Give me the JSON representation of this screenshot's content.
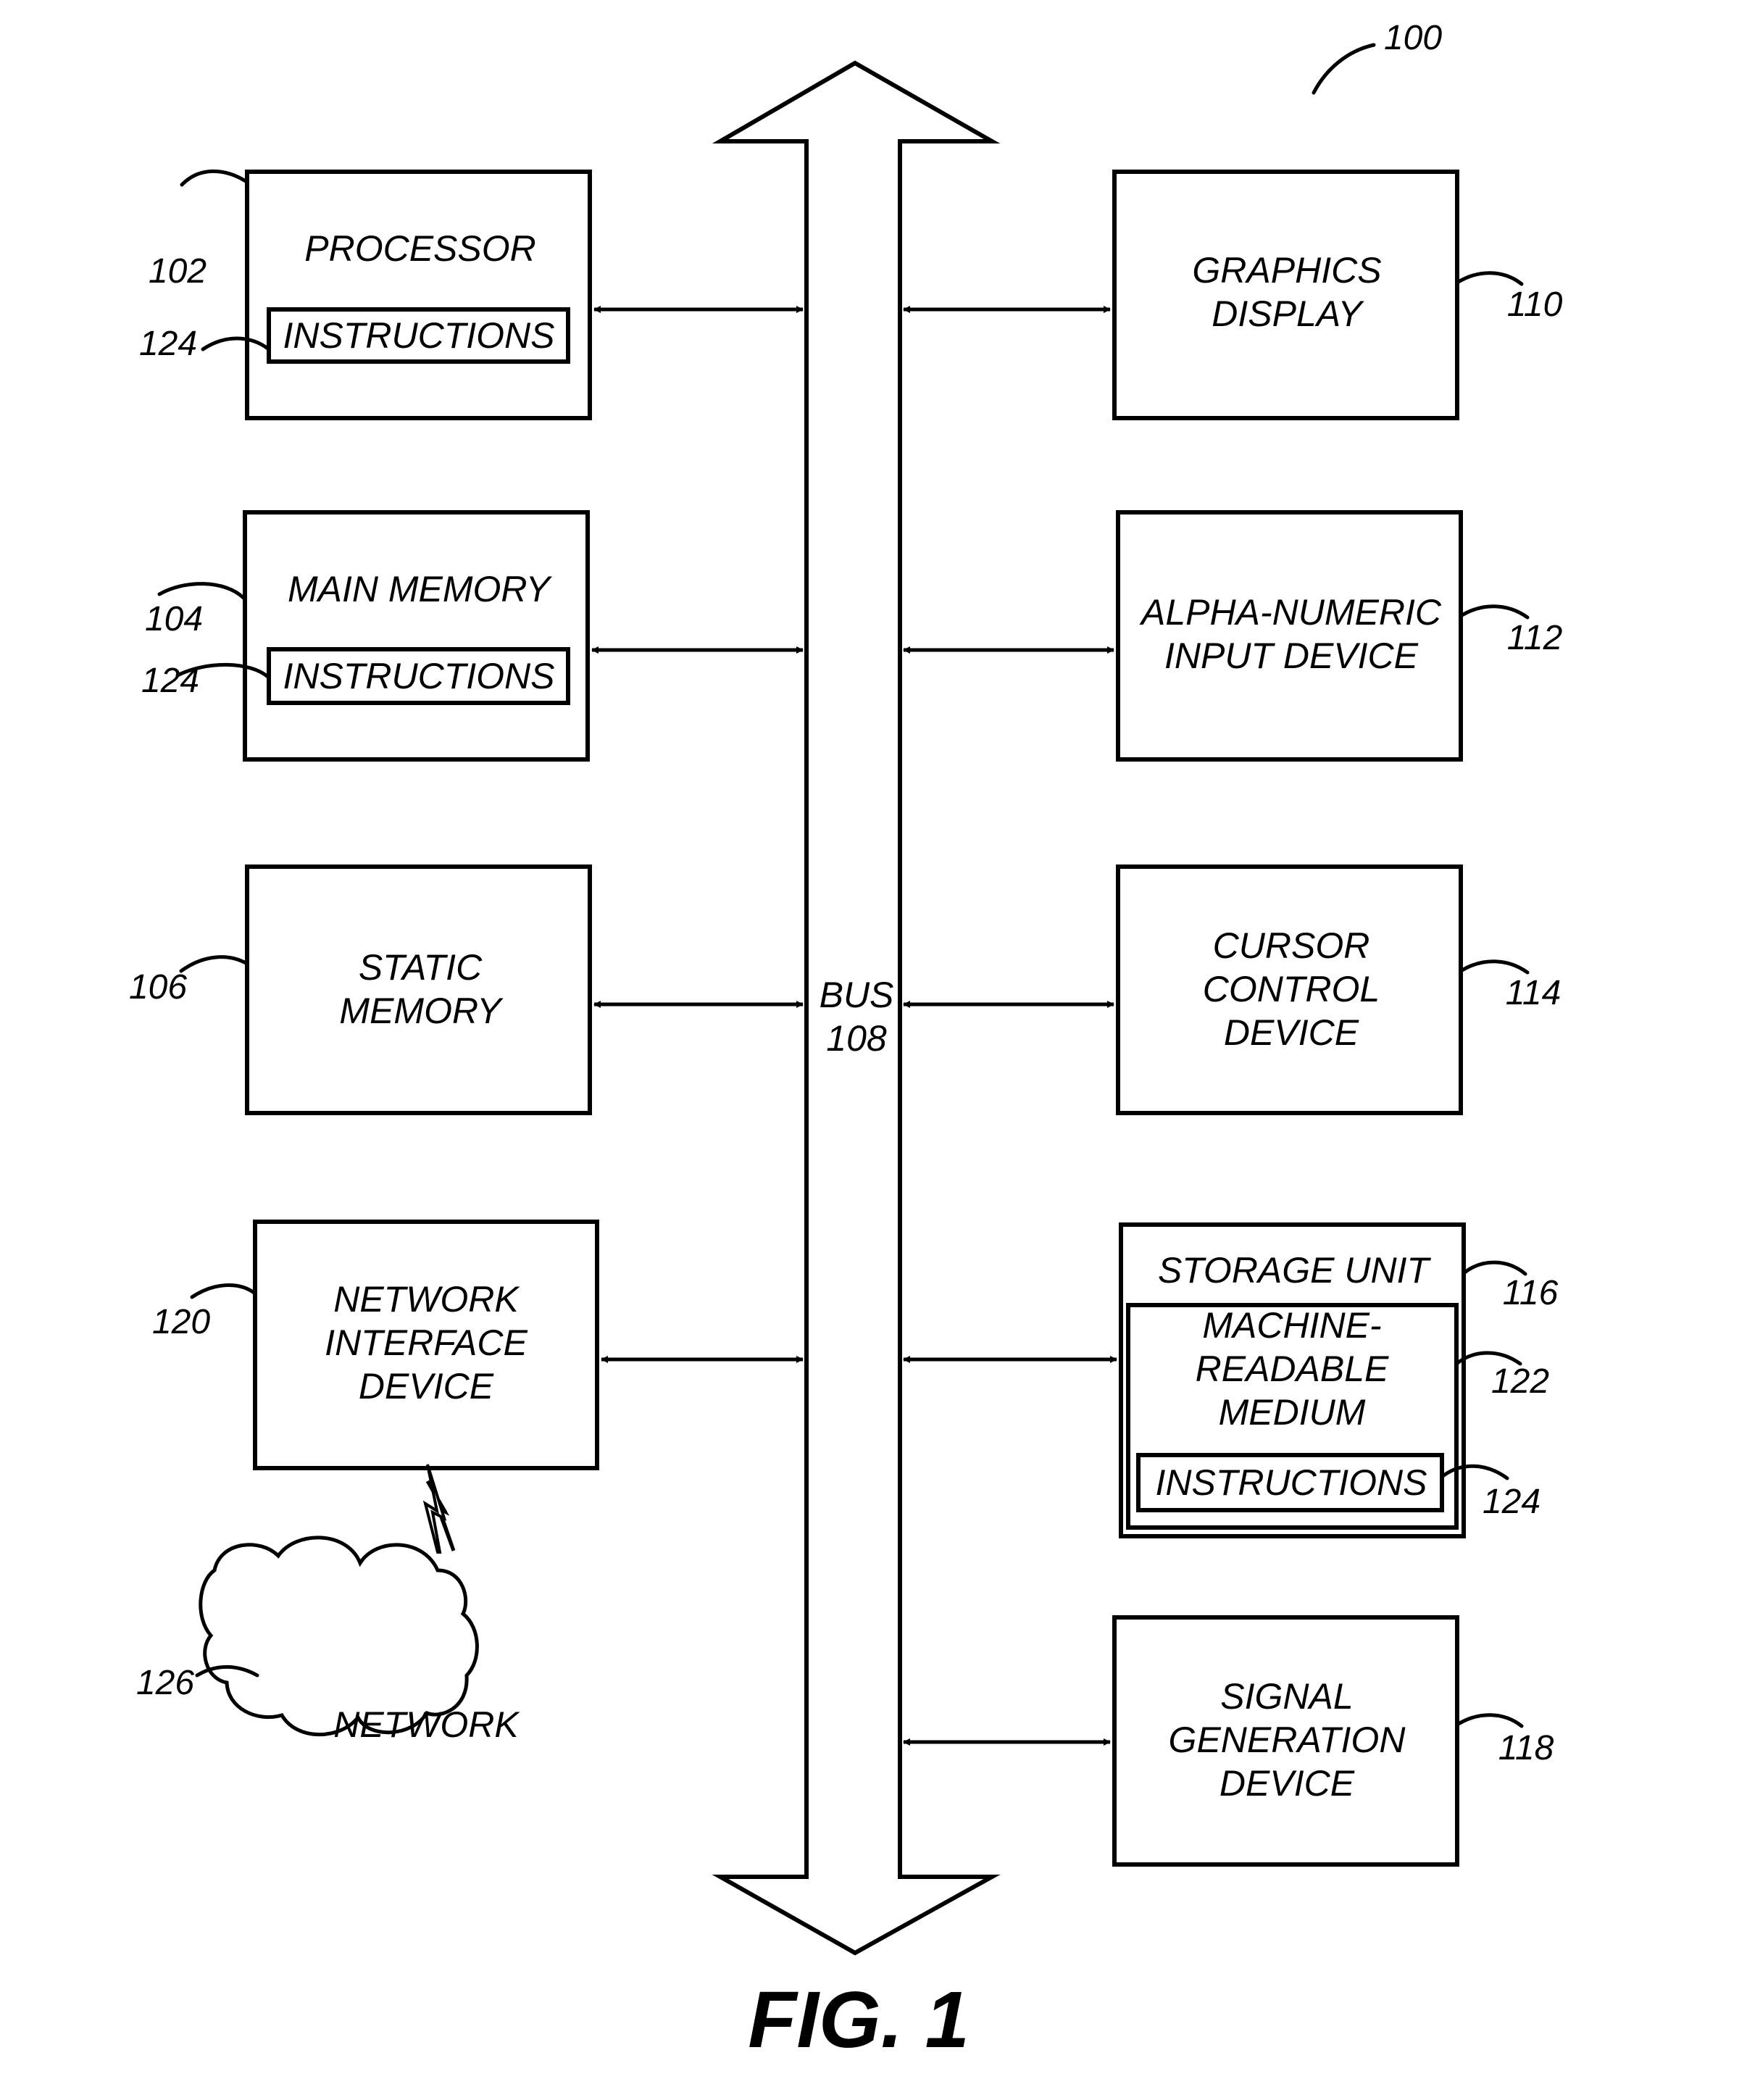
{
  "figure": {
    "ref": "100",
    "caption": "FIG. 1"
  },
  "bus": {
    "line1": "BUS",
    "line2": "108"
  },
  "left_blocks": {
    "processor": {
      "label": "PROCESSOR",
      "ref": "102",
      "sub_label": "INSTRUCTIONS",
      "sub_ref": "124"
    },
    "main_memory": {
      "label": "MAIN MEMORY",
      "ref": "104",
      "sub_label": "INSTRUCTIONS",
      "sub_ref": "124"
    },
    "static_memory": {
      "line1": "STATIC",
      "line2": "MEMORY",
      "ref": "106"
    },
    "network_interface": {
      "line1": "NETWORK",
      "line2": "INTERFACE",
      "line3": "DEVICE",
      "ref": "120"
    }
  },
  "right_blocks": {
    "graphics_display": {
      "line1": "GRAPHICS",
      "line2": "DISPLAY",
      "ref": "110"
    },
    "alpha_numeric": {
      "line1": "ALPHA-NUMERIC",
      "line2": "INPUT DEVICE",
      "ref": "112"
    },
    "cursor_control": {
      "line1": "CURSOR",
      "line2": "CONTROL",
      "line3": "DEVICE",
      "ref": "114"
    },
    "storage_unit": {
      "label": "STORAGE UNIT",
      "ref": "116",
      "medium_line1": "MACHINE-",
      "medium_line2": "READABLE",
      "medium_line3": "MEDIUM",
      "medium_ref": "122",
      "sub_label": "INSTRUCTIONS",
      "sub_ref": "124"
    },
    "signal_generation": {
      "line1": "SIGNAL",
      "line2": "GENERATION",
      "line3": "DEVICE",
      "ref": "118"
    }
  },
  "network": {
    "label": "NETWORK",
    "ref": "126"
  }
}
